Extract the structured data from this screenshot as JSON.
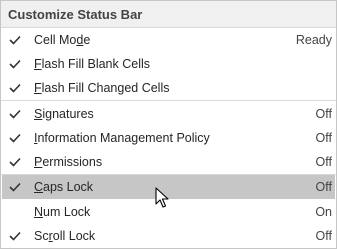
{
  "menu": {
    "title": "Customize Status Bar",
    "items": [
      {
        "pre": "Cell Mo",
        "acc": "d",
        "post": "e",
        "value": "Ready",
        "checked": true
      },
      {
        "pre": "",
        "acc": "F",
        "post": "lash Fill Blank Cells",
        "value": "",
        "checked": true
      },
      {
        "pre": "",
        "acc": "F",
        "post": "lash Fill Changed Cells",
        "value": "",
        "checked": true
      },
      {
        "pre": "",
        "acc": "S",
        "post": "ignatures",
        "value": "Off",
        "checked": true
      },
      {
        "pre": "",
        "acc": "I",
        "post": "nformation Management Policy",
        "value": "Off",
        "checked": true
      },
      {
        "pre": "",
        "acc": "P",
        "post": "ermissions",
        "value": "Off",
        "checked": true
      },
      {
        "pre": "",
        "acc": "C",
        "post": "aps Lock",
        "value": "Off",
        "checked": true,
        "highlighted": true
      },
      {
        "pre": "",
        "acc": "N",
        "post": "um Lock",
        "value": "On",
        "checked": false
      },
      {
        "pre": "Sc",
        "acc": "r",
        "post": "oll Lock",
        "value": "Off",
        "checked": true
      }
    ]
  },
  "colors": {
    "highlight": "#c6c6c6",
    "header_bg": "#f0f0f0",
    "text": "#262626"
  },
  "icons": {
    "check": "check-icon",
    "cursor": "mouse-pointer-icon"
  }
}
